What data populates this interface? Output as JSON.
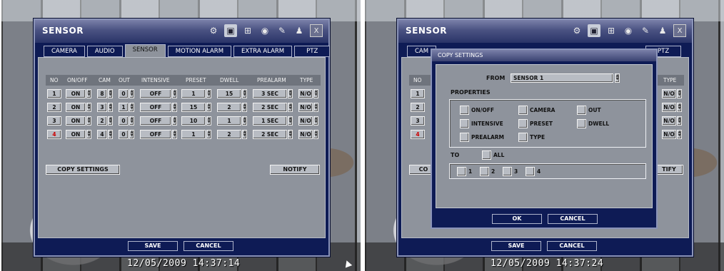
{
  "left": {
    "window": {
      "title": "SENSOR",
      "title_icons": [
        "gear-icon",
        "camera-icon",
        "network-icon",
        "disk-icon",
        "backup-icon",
        "user-icon",
        "close-icon"
      ],
      "close_label": "X"
    },
    "tabs": [
      "CAMERA",
      "AUDIO",
      "SENSOR",
      "MOTION ALARM",
      "EXTRA ALARM",
      "PTZ"
    ],
    "active_tab": "SENSOR",
    "table": {
      "headers": [
        "NO",
        "ON/OFF",
        "CAM",
        "OUT",
        "INTENSIVE",
        "PRESET",
        "DWELL",
        "PREALARM",
        "TYPE"
      ],
      "rows": [
        {
          "no": "1",
          "onoff": "ON",
          "cam": "8",
          "out": "0",
          "intensive": "OFF",
          "preset": "1",
          "dwell": "15",
          "prealarm": "3 SEC",
          "type": "N/O"
        },
        {
          "no": "2",
          "onoff": "ON",
          "cam": "3",
          "out": "1",
          "intensive": "OFF",
          "preset": "15",
          "dwell": "2",
          "prealarm": "2 SEC",
          "type": "N/O"
        },
        {
          "no": "3",
          "onoff": "ON",
          "cam": "2",
          "out": "0",
          "intensive": "OFF",
          "preset": "10",
          "dwell": "1",
          "prealarm": "1 SEC",
          "type": "N/O"
        },
        {
          "no": "4",
          "onoff": "ON",
          "cam": "4",
          "out": "0",
          "intensive": "OFF",
          "preset": "1",
          "dwell": "2",
          "prealarm": "2 SEC",
          "type": "N/O"
        }
      ]
    },
    "copy_settings_label": "COPY SETTINGS",
    "notify_label": "NOTIFY",
    "save_label": "SAVE",
    "cancel_label": "CANCEL",
    "timestamp": "12/05/2009 14:37:14"
  },
  "right": {
    "window": {
      "title": "SENSOR",
      "close_label": "X"
    },
    "tabs_visible": [
      "CAM",
      "PTZ"
    ],
    "table_visible": {
      "no_header": "NO",
      "type_header": "TYPE",
      "nos": [
        "1",
        "2",
        "3",
        "4"
      ],
      "types": [
        "N/O",
        "N/O",
        "N/O",
        "N/O"
      ]
    },
    "copy_partial": "CO",
    "notify_partial": "TIFY",
    "dialog": {
      "title": "COPY SETTINGS",
      "from_label": "FROM",
      "from_value": "SENSOR 1",
      "properties_label": "PROPERTIES",
      "properties": [
        "ON/OFF",
        "CAMERA",
        "OUT",
        "INTENSIVE",
        "PRESET",
        "DWELL",
        "PREALARM",
        "TYPE"
      ],
      "to_label": "TO",
      "all_label": "ALL",
      "targets": [
        "1",
        "2",
        "3",
        "4"
      ],
      "ok_label": "OK",
      "cancel_label": "CANCEL"
    },
    "save_label": "SAVE",
    "cancel_label": "CANCEL",
    "timestamp": "12/05/2009 14:37:24"
  }
}
